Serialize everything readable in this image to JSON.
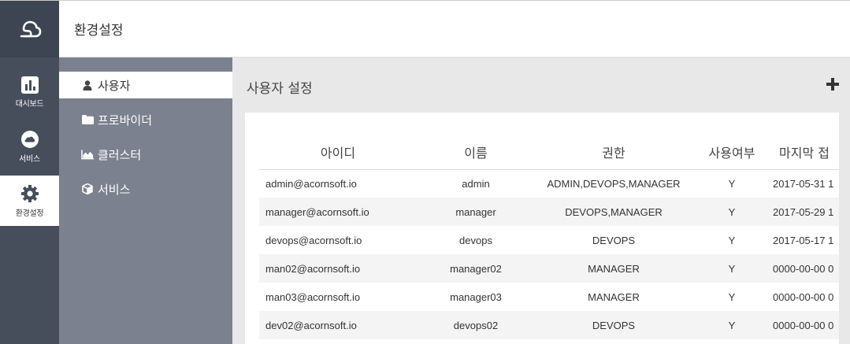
{
  "rail": {
    "items": [
      {
        "label": "대시보드",
        "icon": "bar-chart-icon"
      },
      {
        "label": "서비스",
        "icon": "cloud-icon"
      },
      {
        "label": "환경설정",
        "icon": "gear-icon"
      }
    ]
  },
  "header": {
    "title": "환경설정"
  },
  "subnav": {
    "items": [
      {
        "label": "사용자",
        "icon": "user-icon"
      },
      {
        "label": "프로바이더",
        "icon": "folder-icon"
      },
      {
        "label": "클러스터",
        "icon": "area-chart-icon"
      },
      {
        "label": "서비스",
        "icon": "cube-icon"
      }
    ]
  },
  "main": {
    "title": "사용자 설정",
    "add_label": "+"
  },
  "table": {
    "headers": [
      "아이디",
      "이름",
      "권한",
      "사용여부",
      "마지막 접"
    ],
    "rows": [
      [
        "admin@acornsoft.io",
        "admin",
        "ADMIN,DEVOPS,MANAGER",
        "Y",
        "2017-05-31 1"
      ],
      [
        "manager@acornsoft.io",
        "manager",
        "DEVOPS,MANAGER",
        "Y",
        "2017-05-29 1"
      ],
      [
        "devops@acornsoft.io",
        "devops",
        "DEVOPS",
        "Y",
        "2017-05-17 1"
      ],
      [
        "man02@acornsoft.io",
        "manager02",
        "MANAGER",
        "Y",
        "0000-00-00 0"
      ],
      [
        "man03@acornsoft.io",
        "manager03",
        "MANAGER",
        "Y",
        "0000-00-00 0"
      ],
      [
        "dev02@acornsoft.io",
        "devops02",
        "DEVOPS",
        "Y",
        "0000-00-00 0"
      ]
    ]
  },
  "colors": {
    "rail_bg": "#464e5c",
    "subnav_bg": "#7b818e",
    "main_bg": "#e8e8e8",
    "active_bg": "#ffffff"
  }
}
